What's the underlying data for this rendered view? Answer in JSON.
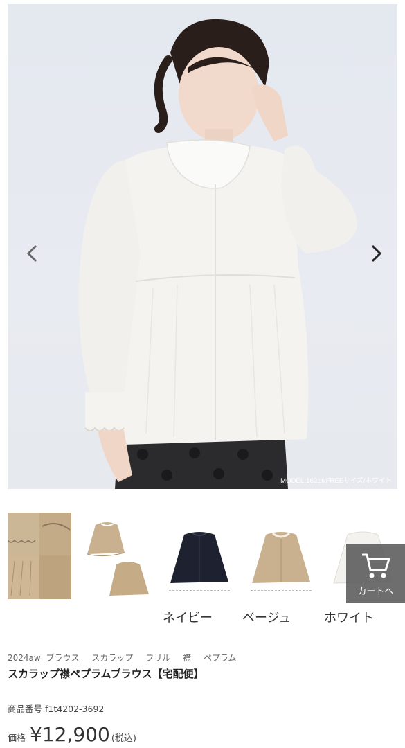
{
  "hero": {
    "model_caption": "MODEL:162㎝/FREEサイズ/ホワイト",
    "prev_icon": "chevron-left-icon",
    "next_icon": "chevron-right-icon"
  },
  "thumbnails": [
    {
      "name": "detail-collage"
    },
    {
      "name": "beige-front-back"
    },
    {
      "name": "navy"
    },
    {
      "name": "beige"
    },
    {
      "name": "white"
    }
  ],
  "color_labels": [
    "ネイビー",
    "ベージュ",
    "ホワイト"
  ],
  "cart": {
    "label": "カートへ",
    "icon": "cart-icon"
  },
  "product": {
    "tags": [
      "2024aw",
      "ブラウス",
      "スカラップ",
      "フリル",
      "襟",
      "ペプラム"
    ],
    "title": "スカラップ襟ペプラムブラウス【宅配便】",
    "sku": "商品番号 f1t4202-3692",
    "price_label": "価格",
    "price": "¥12,900",
    "tax_note": "(税込)"
  },
  "colors": {
    "beige": "#c9b08e",
    "navy": "#1e2230",
    "white": "#f3f2ee",
    "overlay": "#555555"
  }
}
